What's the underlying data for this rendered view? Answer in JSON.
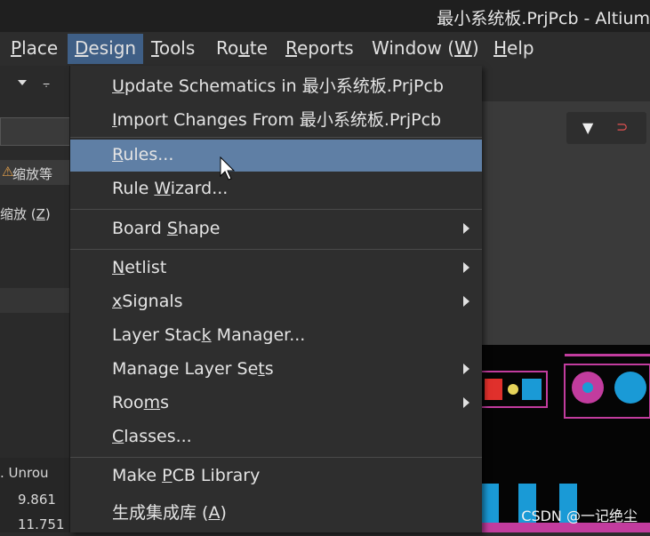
{
  "window": {
    "title": "最小系统板.PrjPcb - Altium"
  },
  "menubar": {
    "items": [
      {
        "pre": "",
        "ul": "P",
        "post": "lace"
      },
      {
        "pre": "",
        "ul": "D",
        "post": "esign"
      },
      {
        "pre": "",
        "ul": "T",
        "post": "ools"
      },
      {
        "pre": "Ro",
        "ul": "u",
        "post": "te"
      },
      {
        "pre": "",
        "ul": "R",
        "post": "eports"
      },
      {
        "pre": "Window (",
        "ul": "W",
        "post": ")"
      },
      {
        "pre": "",
        "ul": "H",
        "post": "elp"
      }
    ]
  },
  "leftpanel": {
    "zoom_label": "缩放等",
    "zoom2": "缩放 (",
    "zoom2_ul": "Z",
    "zoom2_post": ")",
    "table_header": ". Unrou",
    "row1": "9.861",
    "row2": "11.751"
  },
  "design_menu": {
    "items": [
      {
        "pre": "",
        "ul": "U",
        "post": "pdate Schematics in 最小系统板.PrjPcb",
        "sub": false
      },
      {
        "pre": "",
        "ul": "I",
        "post": "mport Changes From 最小系统板.PrjPcb",
        "sub": false
      },
      {
        "pre": "",
        "ul": "R",
        "post": "ules...",
        "sub": false
      },
      {
        "pre": "Rule ",
        "ul": "W",
        "post": "izard...",
        "sub": false
      },
      {
        "pre": "Board ",
        "ul": "S",
        "post": "hape",
        "sub": true
      },
      {
        "pre": "",
        "ul": "N",
        "post": "etlist",
        "sub": true
      },
      {
        "pre": "",
        "ul": "x",
        "post": "Signals",
        "sub": true
      },
      {
        "pre": "Layer Stac",
        "ul": "k",
        "post": " Manager...",
        "sub": false
      },
      {
        "pre": "Manage Layer Se",
        "ul": "t",
        "post": "s",
        "sub": true
      },
      {
        "pre": "Roo",
        "ul": "m",
        "post": "s",
        "sub": true
      },
      {
        "pre": "",
        "ul": "C",
        "post": "lasses...",
        "sub": false
      },
      {
        "pre": "Make ",
        "ul": "P",
        "post": "CB Library",
        "sub": false
      },
      {
        "pre": "生成集成库 (",
        "ul": "A",
        "post": ")",
        "sub": false
      }
    ]
  },
  "watermark": "CSDN @一记绝尘",
  "colors": {
    "highlight": "#5f7fa5",
    "menubar_active": "#3f5f86",
    "pcb_magenta": "#c23c9e",
    "pcb_red": "#e0302c",
    "pcb_blue": "#1a9ad6"
  },
  "icons": [
    "filter-icon",
    "pin-icon",
    "chevron-down-icon",
    "submenu-arrow-icon",
    "mouse-cursor-icon",
    "net-icon"
  ]
}
